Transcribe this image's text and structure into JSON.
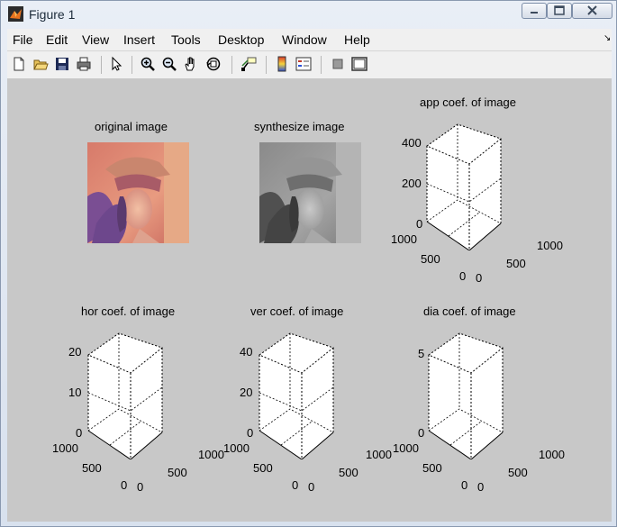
{
  "window": {
    "title": "Figure 1"
  },
  "menu": [
    "File",
    "Edit",
    "View",
    "Insert",
    "Tools",
    "Desktop",
    "Window",
    "Help"
  ],
  "toolbar": [
    "new-figure-icon",
    "open-icon",
    "save-icon",
    "print-icon",
    "pointer-icon",
    "zoom-in-icon",
    "zoom-out-icon",
    "pan-hand-icon",
    "rotate-3d-icon",
    "data-cursor-icon",
    "colorbar-icon",
    "legend-icon",
    "hide-plot-tools-icon",
    "show-plot-tools-icon"
  ],
  "subplots": {
    "original": {
      "title": "original image"
    },
    "synth": {
      "title": "synthesize image"
    },
    "app": {
      "title": "app coef. of image",
      "z_ticks": [
        "400",
        "200",
        "0"
      ],
      "x_ticks": [
        "1000",
        "500",
        "0"
      ],
      "y_ticks": [
        "0",
        "500",
        "1000"
      ]
    },
    "hor": {
      "title": "hor coef. of image",
      "z_ticks": [
        "20",
        "10",
        "0"
      ],
      "x_ticks": [
        "1000",
        "500",
        "0"
      ],
      "y_ticks": [
        "0",
        "500",
        "1000"
      ]
    },
    "ver": {
      "title": "ver coef. of image",
      "z_ticks": [
        "40",
        "20",
        "0"
      ],
      "x_ticks": [
        "1000",
        "500",
        "0"
      ],
      "y_ticks": [
        "0",
        "500",
        "1000"
      ]
    },
    "dia": {
      "title": "dia coef. of image",
      "z_ticks": [
        "5",
        "0"
      ],
      "x_ticks": [
        "1000",
        "500",
        "0"
      ],
      "y_ticks": [
        "0",
        "500",
        "1000"
      ]
    }
  }
}
